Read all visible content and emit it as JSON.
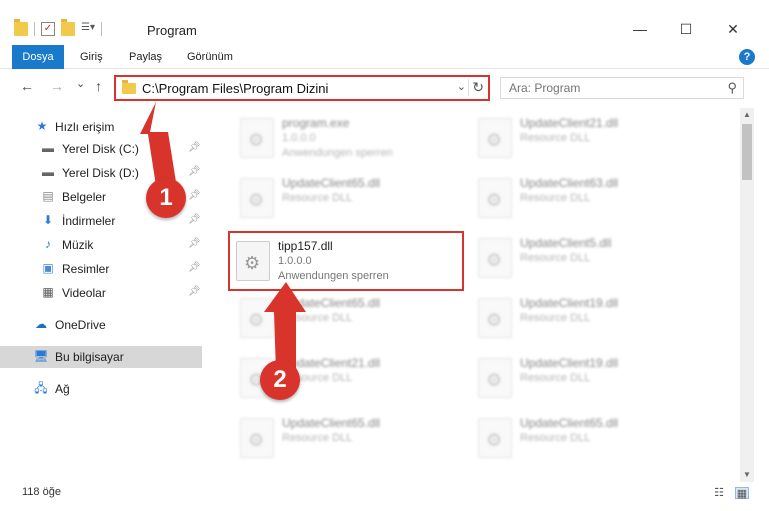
{
  "window": {
    "title": "Program",
    "minimize": "—",
    "maximize": "☐",
    "close": "✕"
  },
  "ribbon": {
    "tabs": [
      "Dosya",
      "Giriş",
      "Paylaş",
      "Görünüm"
    ],
    "help": "?"
  },
  "navigation": {
    "back": "←",
    "forward": "→",
    "recent": "⌄",
    "up": "↑",
    "address": "C:\\Program Files\\Program Dizini",
    "search_placeholder": "Ara: Program"
  },
  "sidebar": {
    "quick_access": "Hızlı erişim",
    "items": [
      {
        "label": "Yerel Disk (C:)",
        "icon": "drive-icon"
      },
      {
        "label": "Yerel Disk (D:)",
        "icon": "drive-icon"
      },
      {
        "label": "Belgeler",
        "icon": "documents-icon"
      },
      {
        "label": "İndirmeler",
        "icon": "downloads-icon"
      },
      {
        "label": "Müzik",
        "icon": "music-icon"
      },
      {
        "label": "Resimler",
        "icon": "pictures-icon"
      },
      {
        "label": "Videolar",
        "icon": "videos-icon"
      }
    ],
    "onedrive": "OneDrive",
    "this_pc": "Bu bilgisayar",
    "network": "Ağ"
  },
  "files": [
    {
      "name": "program.exe",
      "line2": "1.0.0.0",
      "line3": "Anwendungen sperren",
      "blurred": true
    },
    {
      "name": "UpdateClient21.dll",
      "line2": "Resource DLL",
      "line3": "",
      "blurred": true
    },
    {
      "name": "UpdateClient65.dll",
      "line2": "Resource DLL",
      "line3": "",
      "blurred": true
    },
    {
      "name": "UpdateClient63.dll",
      "line2": "Resource DLL",
      "line3": "",
      "blurred": true
    },
    {
      "name": "tipp157.dll",
      "line2": "1.0.0.0",
      "line3": "Anwendungen sperren",
      "blurred": false
    },
    {
      "name": "UpdateClient5.dll",
      "line2": "Resource DLL",
      "line3": "",
      "blurred": true
    },
    {
      "name": "UpdateClient65.dll",
      "line2": "Resource DLL",
      "line3": "",
      "blurred": true
    },
    {
      "name": "UpdateClient19.dll",
      "line2": "Resource DLL",
      "line3": "",
      "blurred": true
    },
    {
      "name": "UpdateClient21.dll",
      "line2": "Resource DLL",
      "line3": "",
      "blurred": true
    },
    {
      "name": "UpdateClient19.dll",
      "line2": "Resource DLL",
      "line3": "",
      "blurred": true
    },
    {
      "name": "UpdateClient65.dll",
      "line2": "Resource DLL",
      "line3": "",
      "blurred": true
    },
    {
      "name": "UpdateClient65.dll",
      "line2": "Resource DLL",
      "line3": "",
      "blurred": true
    }
  ],
  "annotations": {
    "step1": "1",
    "step2": "2",
    "color": "#d9342b"
  },
  "status": {
    "item_count": "118 öğe"
  }
}
